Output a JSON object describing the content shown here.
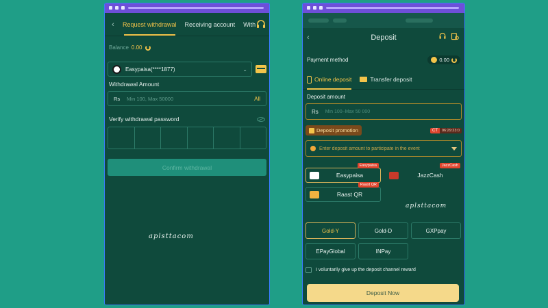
{
  "left": {
    "tabs": [
      "Request withdrawal",
      "Receiving account",
      "With"
    ],
    "balance_label": "Balance",
    "balance_value": "0.00",
    "account_select": "Easypaisa(****1877)",
    "withdrawal_amount_label": "Withdrawal Amount",
    "currency": "Rs",
    "amount_placeholder": "Min 100, Max 50000",
    "all_label": "All",
    "verify_password_label": "Verify withdrawal password",
    "confirm_button": "Confirm withdrawal",
    "watermark": "aplsttacom"
  },
  "right": {
    "title": "Deposit",
    "payment_method_label": "Payment method",
    "balance_value": "0.00",
    "tabs": [
      "Online deposit",
      "Transfer deposit"
    ],
    "deposit_amount_label": "Deposit amount",
    "currency": "Rs",
    "amount_placeholder": "Min 100–Max 50 000",
    "promotion_label": "Deposit promotion",
    "timer_ct": "CT",
    "timer_value": "06:29:23:0",
    "promotion_placeholder": "Enter deposit amount to participate in the event",
    "channels": [
      {
        "name": "Easypaisa",
        "tag": "Easypaisa"
      },
      {
        "name": "JazzCash",
        "tag": "JazzCash"
      },
      {
        "name": "Raast QR",
        "tag": "Raast QR"
      }
    ],
    "gateways": [
      "Gold-Y",
      "Gold-D",
      "GXPpay",
      "EPayGlobal",
      "INPay"
    ],
    "reward_checkbox": "I voluntarily give up the deposit channel reward",
    "deposit_button": "Deposit Now",
    "watermark": "aplsttacom"
  },
  "colors": {
    "background": "#1f9e87",
    "phone": "#0f4a3c",
    "accent_gold": "#f3c44a",
    "tag_red": "#e0452e"
  }
}
